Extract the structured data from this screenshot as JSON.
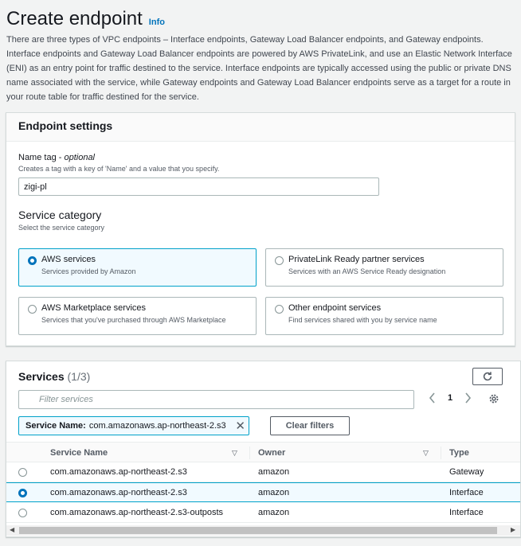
{
  "page": {
    "title": "Create endpoint",
    "info_link": "Info",
    "intro": "There are three types of VPC endpoints – Interface endpoints, Gateway Load Balancer endpoints, and Gateway endpoints. Interface endpoints and Gateway Load Balancer endpoints are powered by AWS PrivateLink, and use an Elastic Network Interface (ENI) as an entry point for traffic destined to the service. Interface endpoints are typically accessed using the public or private DNS name associated with the service, while Gateway endpoints and Gateway Load Balancer endpoints serve as a target for a route in your route table for traffic destined for the service."
  },
  "settings": {
    "header": "Endpoint settings",
    "name_tag_label": "Name tag - ",
    "name_tag_optional": "optional",
    "name_tag_desc": "Creates a tag with a key of 'Name' and a value that you specify.",
    "name_tag_value": "zigi-pl",
    "category_label": "Service category",
    "category_desc": "Select the service category",
    "options": [
      {
        "title": "AWS services",
        "desc": "Services provided by Amazon",
        "selected": true
      },
      {
        "title": "PrivateLink Ready partner services",
        "desc": "Services with an AWS Service Ready designation",
        "selected": false
      },
      {
        "title": "AWS Marketplace services",
        "desc": "Services that you've purchased through AWS Marketplace",
        "selected": false
      },
      {
        "title": "Other endpoint services",
        "desc": "Find services shared with you by service name",
        "selected": false
      }
    ]
  },
  "services": {
    "title": "Services",
    "count": "(1/3)",
    "filter_placeholder": "Filter services",
    "page": "1",
    "token_key": "Service Name:",
    "token_value": "com.amazonaws.ap-northeast-2.s3",
    "clear_filters": "Clear filters",
    "columns": [
      "Service Name",
      "Owner",
      "Type"
    ],
    "rows": [
      {
        "name": "com.amazonaws.ap-northeast-2.s3",
        "owner": "amazon",
        "type": "Gateway",
        "selected": false
      },
      {
        "name": "com.amazonaws.ap-northeast-2.s3",
        "owner": "amazon",
        "type": "Interface",
        "selected": true
      },
      {
        "name": "com.amazonaws.ap-northeast-2.s3-outposts",
        "owner": "amazon",
        "type": "Interface",
        "selected": false
      }
    ]
  },
  "icons": {
    "refresh": "refresh-icon",
    "search": "search-icon",
    "prev": "chevron-left-icon",
    "next": "chevron-right-icon",
    "settings": "gear-icon",
    "close": "close-icon",
    "sort": "caret-down-icon"
  },
  "colors": {
    "accent": "#0073bb",
    "selected_border": "#00a1c9",
    "selected_bg": "#f1faff"
  }
}
